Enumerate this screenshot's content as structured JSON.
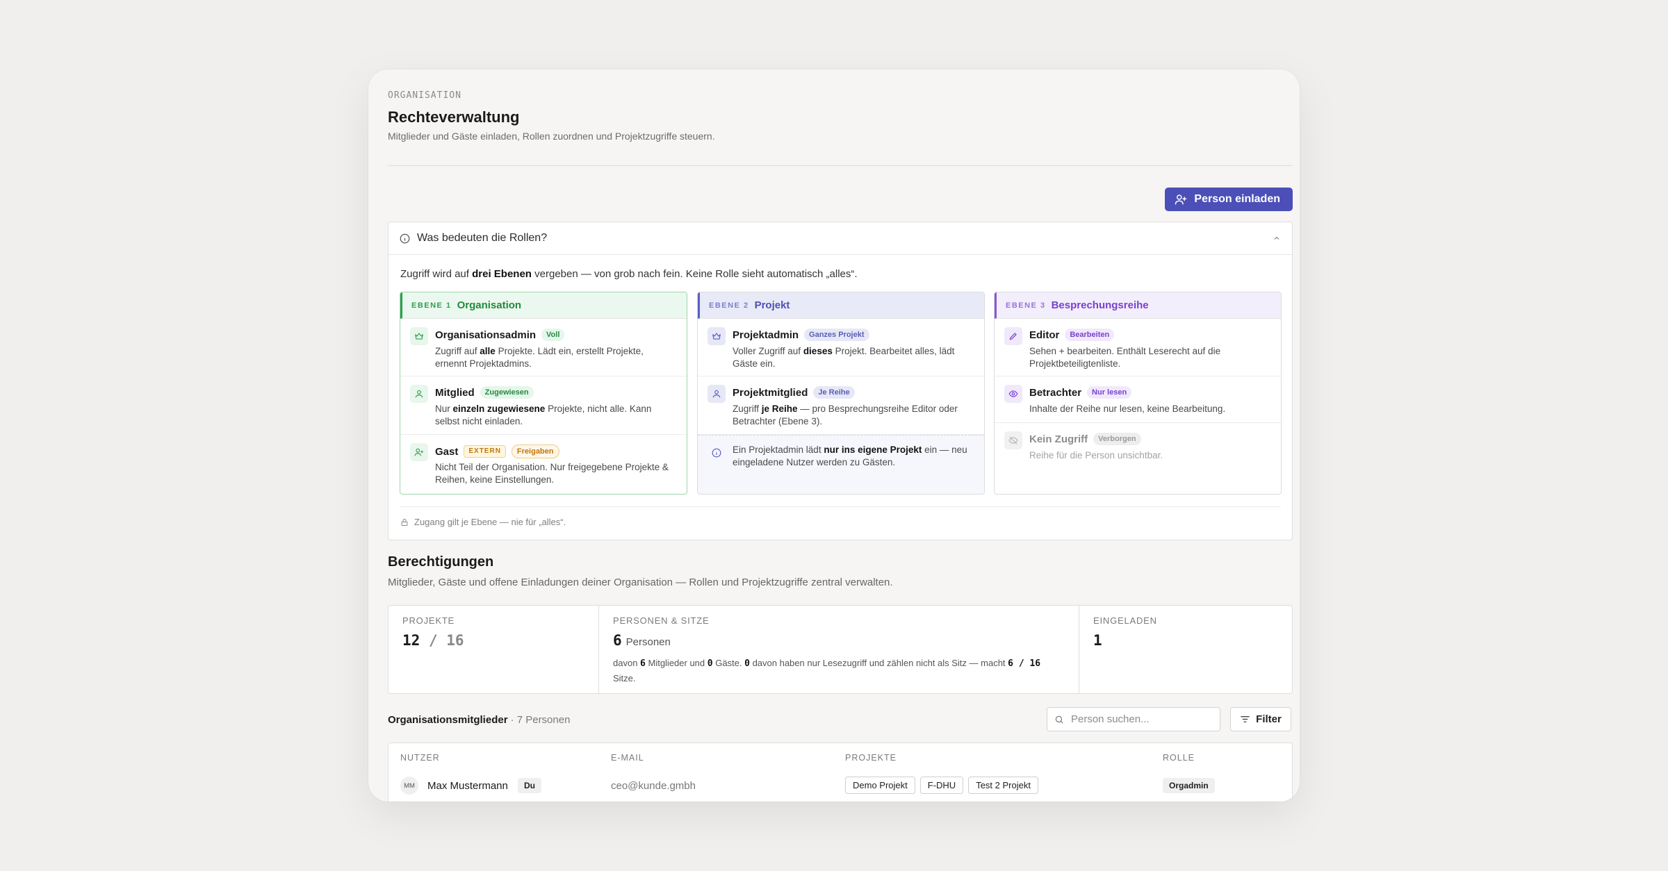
{
  "header": {
    "overline": "ORGANISATION",
    "title": "Rechteverwaltung",
    "subtitle": "Mitglieder und Gäste einladen, Rollen zuordnen und Projektzugriffe steuern.",
    "invite_label": "Person einladen"
  },
  "roles": {
    "heading": "Was bedeuten die Rollen?",
    "intro_pre": "Zugriff wird auf ",
    "intro_bold": "drei Ebenen",
    "intro_post": " vergeben — von grob nach fein. Keine Rolle sieht automatisch „alles“.",
    "footer": "Zugang gilt je Ebene — nie für „alles“.",
    "levels": [
      {
        "level": "EBENE 1",
        "title": "Organisation",
        "items": [
          {
            "name": "Organisationsadmin",
            "badge": "Voll",
            "d1": "Zugriff auf ",
            "b": "alle",
            "d2": " Projekte. Lädt ein, erstellt Projekte, ernennt Projektadmins."
          },
          {
            "name": "Mitglied",
            "badge": "Zugewiesen",
            "d1": "Nur ",
            "b": "einzeln zugewiesene",
            "d2": " Projekte, nicht alle. Kann selbst nicht einladen."
          },
          {
            "name": "Gast",
            "badge": "EXTERN",
            "badge2": "Freigaben",
            "d1": "Nicht Teil der Organisation. Nur freigegebene Projekte & Reihen, keine Einstellungen.",
            "b": "",
            "d2": ""
          }
        ]
      },
      {
        "level": "EBENE 2",
        "title": "Projekt",
        "items": [
          {
            "name": "Projektadmin",
            "badge": "Ganzes Projekt",
            "d1": "Voller Zugriff auf ",
            "b": "dieses",
            "d2": " Projekt. Bearbeitet alles, lädt Gäste ein."
          },
          {
            "name": "Projektmitglied",
            "badge": "Je Reihe",
            "d1": "Zugriff ",
            "b": "je Reihe",
            "d2": " — pro Besprechungsreihe Editor oder Betrachter (Ebene 3)."
          }
        ],
        "note": {
          "d1": "Ein Projektadmin lädt ",
          "b": "nur ins eigene Projekt",
          "d2": " ein — neu eingeladene Nutzer werden zu Gästen."
        }
      },
      {
        "level": "EBENE 3",
        "title": "Besprechungsreihe",
        "items": [
          {
            "name": "Editor",
            "badge": "Bearbeiten",
            "d1": "Sehen + bearbeiten. Enthält Leserecht auf die Projektbeteiligtenliste.",
            "b": "",
            "d2": ""
          },
          {
            "name": "Betrachter",
            "badge": "Nur lesen",
            "d1": "Inhalte der Reihe nur lesen, keine Bearbeitung.",
            "b": "",
            "d2": ""
          },
          {
            "name": "Kein Zugriff",
            "badge": "Verborgen",
            "d1": "Reihe für die Person unsichtbar.",
            "b": "",
            "d2": ""
          }
        ]
      }
    ]
  },
  "permissions": {
    "title": "Berechtigungen",
    "subtitle": "Mitglieder, Gäste und offene Einladungen deiner Organisation — Rollen und Projektzugriffe zentral verwalten.",
    "stats": {
      "projects_label": "PROJEKTE",
      "projects_used": "12",
      "projects_sep": " / ",
      "projects_total": "16",
      "persons_label": "PERSONEN & SITZE",
      "persons_count": "6",
      "persons_unit": "Personen",
      "detail_1": "davon ",
      "detail_members": "6",
      "detail_2": " Mitglieder und ",
      "detail_guests": "0",
      "detail_3": " Gäste. ",
      "detail_readonly": "0",
      "detail_4": " davon haben nur Lesezugriff und zählen nicht als Sitz — macht ",
      "detail_seats": "6 / 16",
      "detail_5": " Sitze.",
      "invited_label": "EINGELADEN",
      "invited_count": "1"
    }
  },
  "members": {
    "title": "Organisationsmitglieder",
    "count": "· 7 Personen",
    "search_placeholder": "Person suchen...",
    "filter_label": "Filter",
    "columns": [
      "NUTZER",
      "E-MAIL",
      "PROJEKTE",
      "ROLLE"
    ],
    "rows": [
      {
        "initials": "MM",
        "name": "Max Mustermann",
        "you": "Du",
        "email": "ceo@kunde.gmbh",
        "projects": [
          "Demo Projekt",
          "F-DHU",
          "Test 2 Projekt"
        ],
        "role": "Orgadmin"
      }
    ]
  },
  "colors": {
    "accent": "#4b4fb7",
    "level1": "#2f9e4f",
    "level2": "#5a5dc4",
    "level3": "#7a3fd0"
  }
}
